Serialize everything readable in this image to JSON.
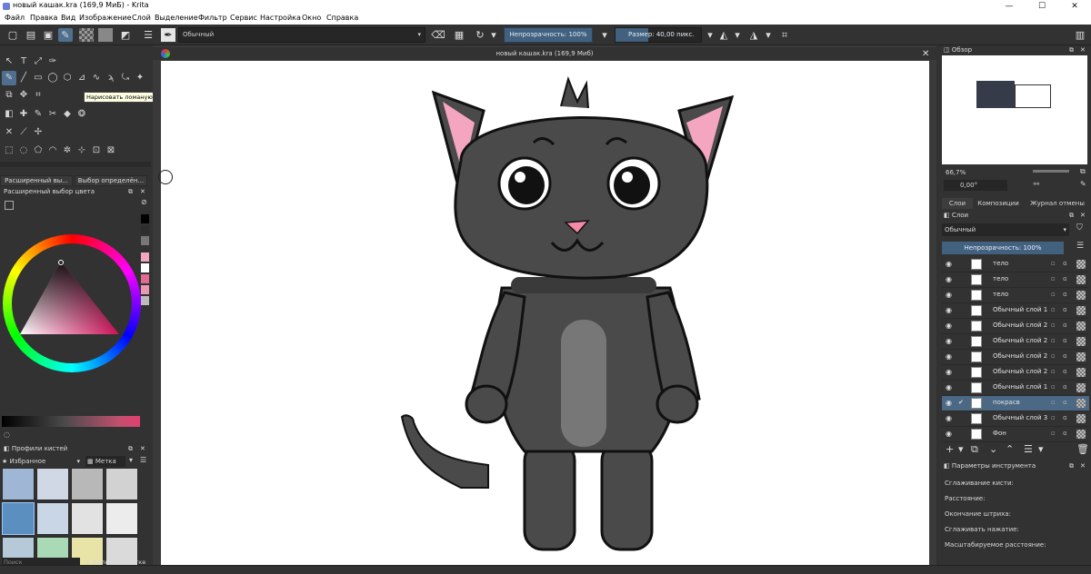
{
  "window": {
    "title": "новый кашак.kra (169,9 МиБ)  - Krita",
    "minimize": "—",
    "maximize": "☐",
    "close": "✕"
  },
  "menu": [
    "Файл",
    "Правка",
    "Вид",
    "Изображение",
    "Слой",
    "Выделение",
    "Фильтр",
    "Сервис",
    "Настройка",
    "Окно",
    "Справка"
  ],
  "toolbar": {
    "blend_mode": "Обычный",
    "opacity": "Непрозрачность: 100%",
    "size": "Размер: 40,00 пикс."
  },
  "tooltip": "Нарисовать ломаную линию. Shift+ щелчок мышью завершает линию.",
  "left": {
    "tab_advanced": "Расширенный вы...",
    "tab_selection": "Выбор определён...",
    "color_dock_title": "Расширенный выбор цвета",
    "brush_dock_title": "Профили кистей",
    "favorites": "Избранное",
    "tag": "Метка",
    "search_placeholder": "Поиск",
    "filter_by_tag": "Фильтр по метке"
  },
  "document": {
    "title": "новый кашак.kra (169,9 Миб)"
  },
  "right": {
    "overview_title": "Обзор",
    "zoom": "66,7%",
    "rotation": "0,00°",
    "tabs": [
      "Слои",
      "Композиции",
      "Журнал отмены"
    ],
    "layers_title": "Слои",
    "blend": "Обычный",
    "opacity": "Непрозрачность:  100%",
    "layers": [
      {
        "name": "тело",
        "selected": false
      },
      {
        "name": "тело",
        "selected": false
      },
      {
        "name": "тело",
        "selected": false
      },
      {
        "name": "Обычный слой 1",
        "selected": false
      },
      {
        "name": "Обычный слой 2",
        "selected": false
      },
      {
        "name": "Обычный слой 2",
        "selected": false
      },
      {
        "name": "Обычный слой 2",
        "selected": false
      },
      {
        "name": "Обычный слой 2",
        "selected": false
      },
      {
        "name": "Обычный слой 1",
        "selected": false
      },
      {
        "name": "покрасв",
        "selected": true
      },
      {
        "name": "Обычный слой 3",
        "selected": false
      },
      {
        "name": "Фон",
        "selected": false
      }
    ],
    "tool_options_title": "Параметры инструмента",
    "params": [
      "Сглаживание кисти:",
      "Расстояние:",
      "Окончание штриха:",
      "Сглаживать нажатие:",
      "Масштабируемое расстояние:"
    ]
  },
  "colors": {
    "accent": "#41617f",
    "selected_layer": "#4b6985",
    "cat_body": "#4a4a4a",
    "cat_ear_inner": "#f4a6c0",
    "cat_belly": "#777777"
  }
}
